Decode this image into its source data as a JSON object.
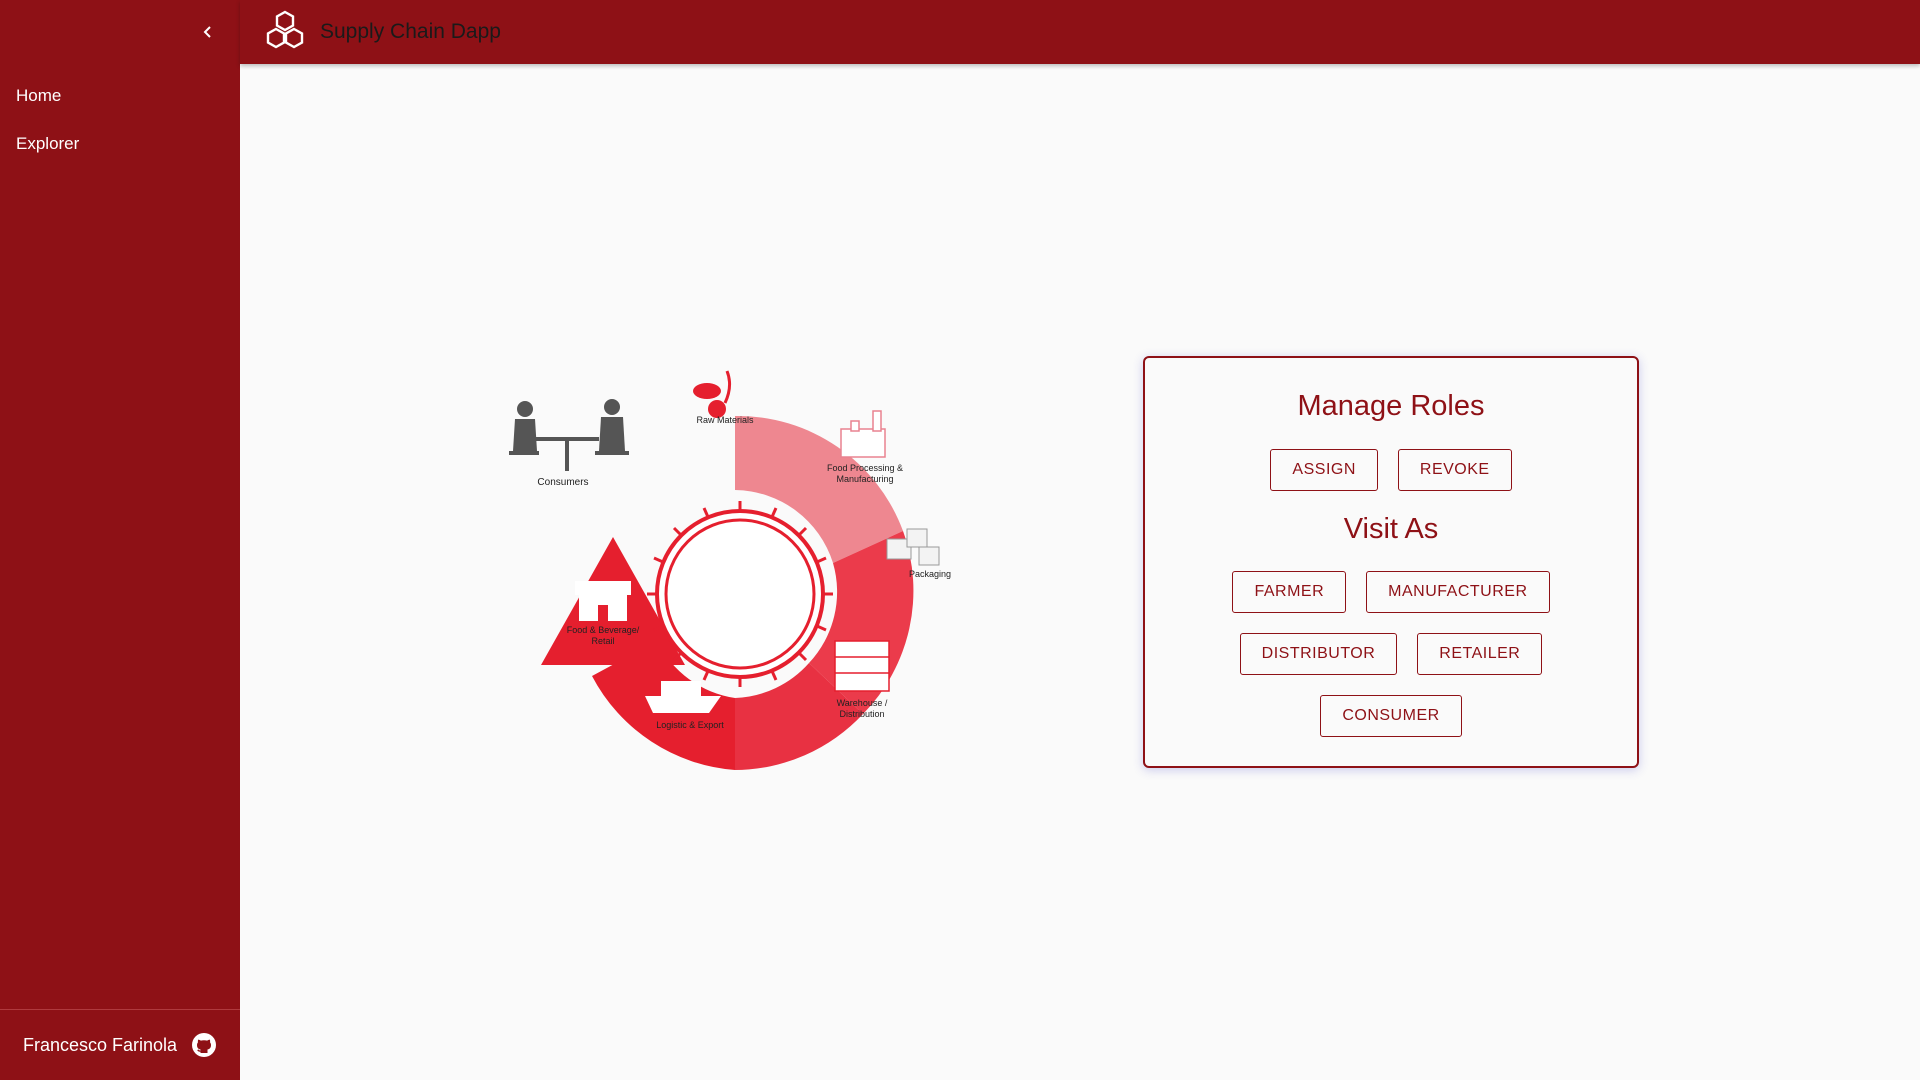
{
  "app": {
    "title": "Supply Chain Dapp"
  },
  "sidebar": {
    "items": [
      {
        "label": "Home"
      },
      {
        "label": "Explorer"
      }
    ],
    "footer": {
      "author": "Francesco Farinola"
    }
  },
  "illustration": {
    "labels": {
      "raw_materials": "Raw Materials",
      "food_processing_1": "Food Processing &",
      "food_processing_2": "Manufacturing",
      "packaging": "Packaging",
      "warehouse_1": "Warehouse /",
      "warehouse_2": "Distribution",
      "logistic": "Logistic & Export",
      "retail_1": "Food & Beverage/",
      "retail_2": "Retail",
      "consumers": "Consumers"
    }
  },
  "manage_roles": {
    "title": "Manage Roles",
    "assign_label": "ASSIGN",
    "revoke_label": "REVOKE"
  },
  "visit_as": {
    "title": "Visit As",
    "farmer_label": "FARMER",
    "manufacturer_label": "MANUFACTURER",
    "distributor_label": "DISTRIBUTOR",
    "retailer_label": "RETAILER",
    "consumer_label": "CONSUMER"
  },
  "colors": {
    "primary": "#8e1116",
    "background": "#fafafa",
    "arrow_light": "#ee8790",
    "arrow_mid": "#eb3b4b",
    "arrow_dark": "#e51f2e"
  }
}
